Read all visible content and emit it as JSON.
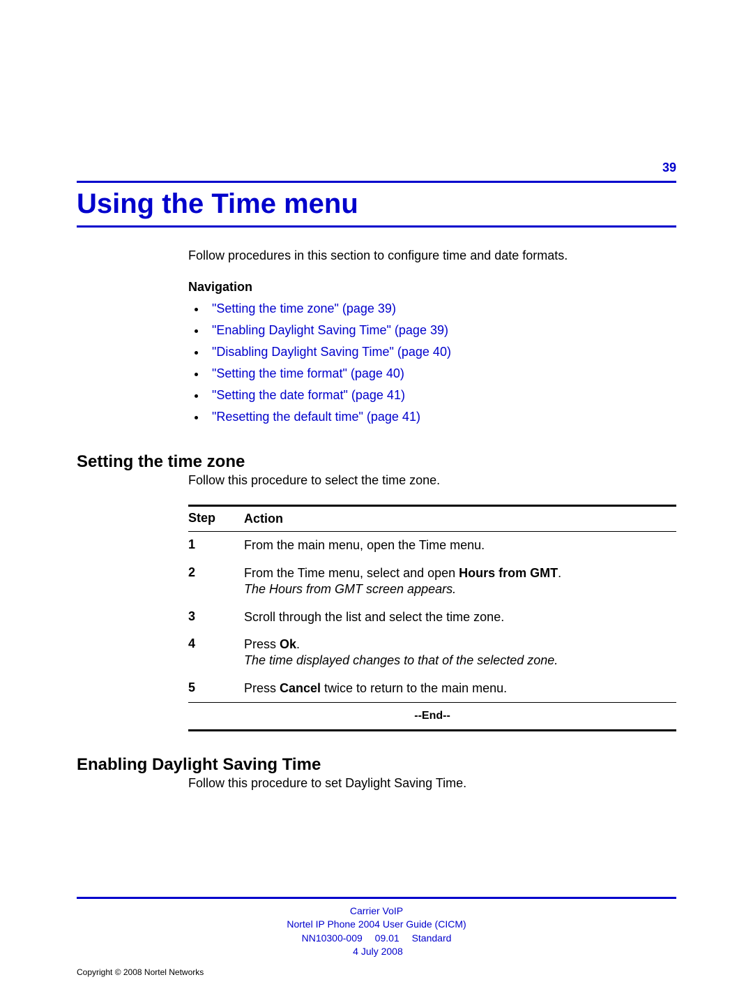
{
  "page_number": "39",
  "chapter_title": "Using the Time menu",
  "intro": "Follow procedures in this section to configure time and date formats.",
  "nav_heading": "Navigation",
  "nav_items": [
    "\"Setting the time zone\" (page 39)",
    "\"Enabling Daylight Saving Time\" (page 39)",
    "\"Disabling Daylight Saving Time\" (page 40)",
    "\"Setting the time format\" (page 40)",
    "\"Setting the date format\" (page 41)",
    "\"Resetting the default time\" (page 41)"
  ],
  "section1": {
    "title": "Setting the time zone",
    "desc": "Follow this procedure to select the time zone.",
    "col_step": "Step",
    "col_action": "Action",
    "steps": [
      {
        "n": "1",
        "a": "From the main menu, open the Time menu.",
        "i": ""
      },
      {
        "n": "2",
        "a_pre": "From the Time menu, select and open ",
        "a_bold": "Hours from GMT",
        "a_post": ".",
        "i": "The Hours from GMT screen appears."
      },
      {
        "n": "3",
        "a": "Scroll through the list and select the time zone.",
        "i": ""
      },
      {
        "n": "4",
        "a_pre": "Press ",
        "a_bold": "Ok",
        "a_post": ".",
        "i": "The time displayed changes to that of the selected zone."
      },
      {
        "n": "5",
        "a_pre": "Press ",
        "a_bold": "Cancel",
        "a_post": " twice to return to the main menu.",
        "i": ""
      }
    ],
    "end": "--End--"
  },
  "section2": {
    "title": "Enabling Daylight Saving Time",
    "desc": "Follow this procedure to set Daylight Saving Time."
  },
  "footer": {
    "line1": "Carrier VoIP",
    "line2": "Nortel IP Phone 2004 User Guide (CICM)",
    "line3": "NN10300-009  09.01  Standard",
    "line4": " 4 July 2008"
  },
  "copyright": "Copyright © 2008 Nortel Networks"
}
